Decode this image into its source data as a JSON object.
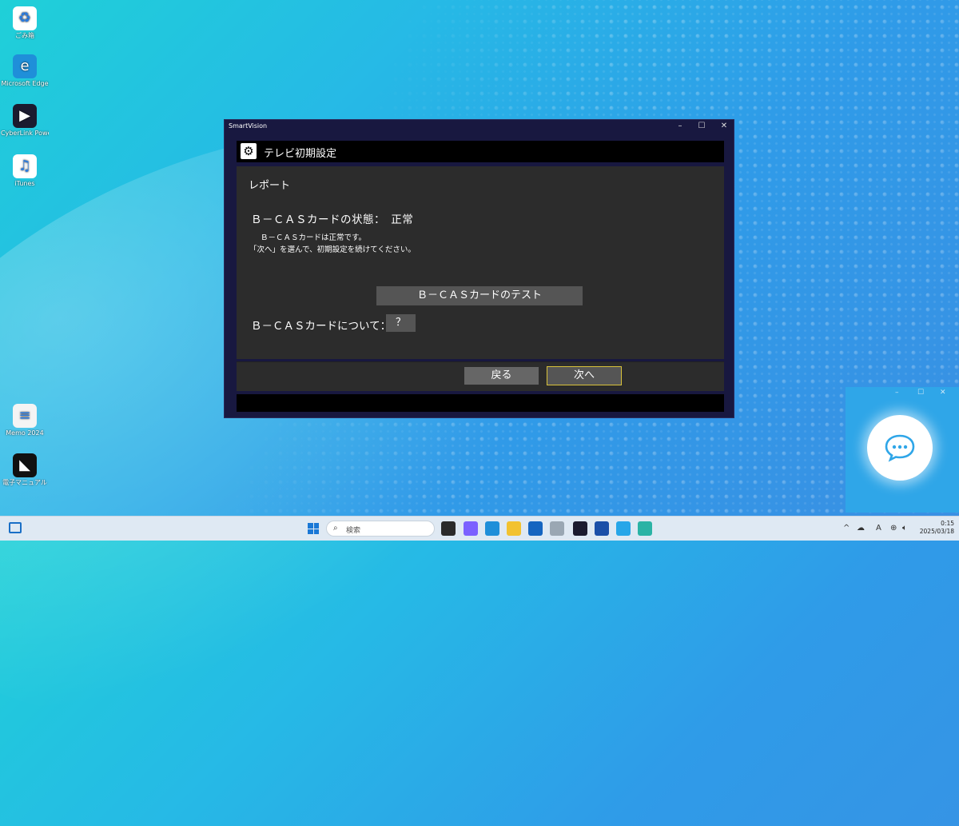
{
  "desktop": {
    "icons": [
      {
        "label": "ごみ箱",
        "glyph": "♻",
        "color": "#ffffff",
        "icon": "recycle-bin-icon"
      },
      {
        "label": "Microsoft Edge",
        "glyph": "e",
        "color": "#1f8fd9",
        "icon": "edge-icon"
      },
      {
        "label": "CyberLink PowerDVD ...",
        "glyph": "▶",
        "color": "#1b1b2f",
        "icon": "powerdvd-icon"
      },
      {
        "label": "iTunes",
        "glyph": "♫",
        "color": "#ffffff",
        "icon": "itunes-icon"
      },
      {
        "label": "Memo 2024",
        "glyph": "≡",
        "color": "#f4f4f4",
        "icon": "text-file-icon"
      },
      {
        "label": "電子マニュアル",
        "glyph": "◣",
        "color": "#111111",
        "icon": "manual-icon"
      }
    ]
  },
  "window": {
    "app_title": "SmartVision",
    "controls": {
      "minimize": "–",
      "maximize": "☐",
      "close": "✕"
    },
    "header_title": "テレビ初期設定",
    "section_heading": "レポート",
    "status_line": "Ｂ－ＣＡＳカードの状態：　正常",
    "message_line1": "Ｂ－ＣＡＳカードは正常です。",
    "message_line2": "「次へ」を選んで、初期設定を続けてください。",
    "test_button": "Ｂ－ＣＡＳカードのテスト",
    "about_label": "Ｂ－ＣＡＳカードについて：",
    "help_button": "？",
    "back_button": "戻る",
    "next_button": "次へ"
  },
  "chat_widget": {
    "minimize": "–",
    "maximize": "☐",
    "close": "✕",
    "icon": "chat-bubble-icon"
  },
  "taskbar": {
    "search_placeholder": "検索",
    "clock_time": "0:15",
    "clock_date": "2025/03/18",
    "ime_indicator": "A",
    "apps": [
      {
        "icon": "file-explorer-icon",
        "color": "#2b2b2b"
      },
      {
        "icon": "copilot-icon",
        "color": "#7b61ff"
      },
      {
        "icon": "edge-icon",
        "color": "#1f8fd9"
      },
      {
        "icon": "folder-icon",
        "color": "#f2c230"
      },
      {
        "icon": "outlook-icon",
        "color": "#1565c0"
      },
      {
        "icon": "settings-icon",
        "color": "#9aa7b3"
      },
      {
        "icon": "powerdvd-icon",
        "color": "#1b1b2f"
      },
      {
        "icon": "smartvision-icon",
        "color": "#1a4fa8"
      },
      {
        "icon": "chat-app-icon",
        "color": "#27a6e8"
      },
      {
        "icon": "globe-app-icon",
        "color": "#2bb3a5"
      }
    ]
  }
}
